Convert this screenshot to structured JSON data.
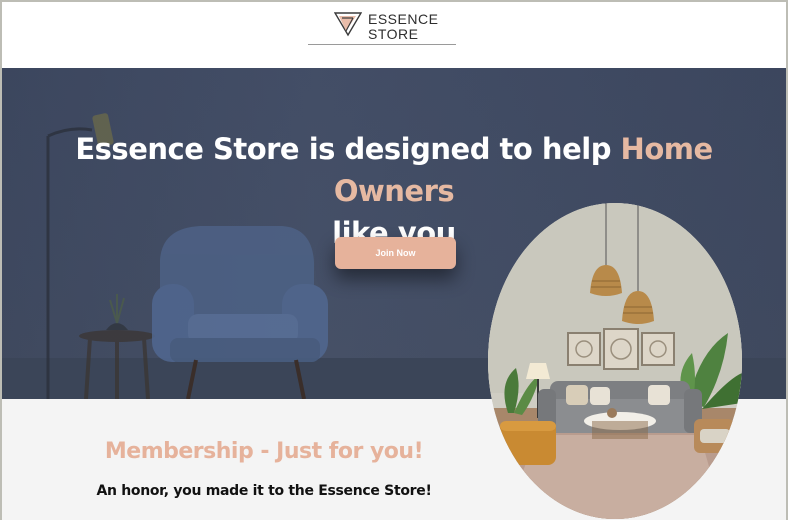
{
  "header": {
    "logo_icon": "triangle-logo-icon",
    "logo_line1": "ESSENCE",
    "logo_line2": "STORE"
  },
  "hero": {
    "title_part1": "Essence Store is designed to help ",
    "title_accent": "Home Owners",
    "title_part2": "like you",
    "join_button": "Join Now"
  },
  "membership": {
    "title": "Membership - Just for you!",
    "subtitle": "An honor, you made it to the Essence Store!"
  },
  "colors": {
    "accent": "#e6b29b",
    "hero_bg": "#414c64",
    "section_bg": "#f4f4f4"
  }
}
